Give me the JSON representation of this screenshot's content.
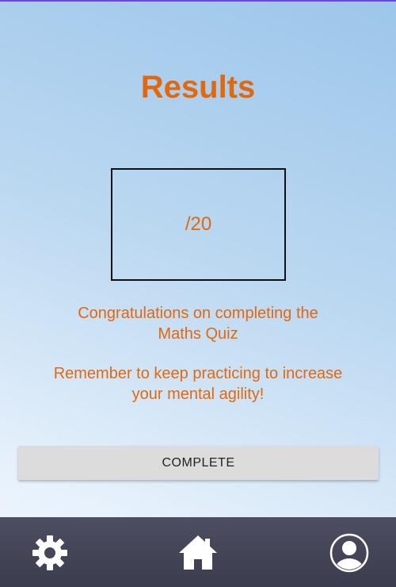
{
  "page": {
    "title": "Results"
  },
  "score": {
    "display": "/20"
  },
  "messages": {
    "congrats_line1": "Congratulations on completing the",
    "congrats_line2": "Maths Quiz",
    "reminder_line1": "Remember to keep practicing to increase",
    "reminder_line2": "your mental agility!"
  },
  "actions": {
    "complete_label": "COMPLETE"
  },
  "bottom_nav": {
    "items": [
      {
        "icon": "gear-icon"
      },
      {
        "icon": "home-icon"
      },
      {
        "icon": "user-profile-icon"
      }
    ]
  },
  "colors": {
    "accent": "#e2680d",
    "nav_background": "#43445a",
    "button_background": "#dcdcdc",
    "top_line": "#6a48d8"
  }
}
